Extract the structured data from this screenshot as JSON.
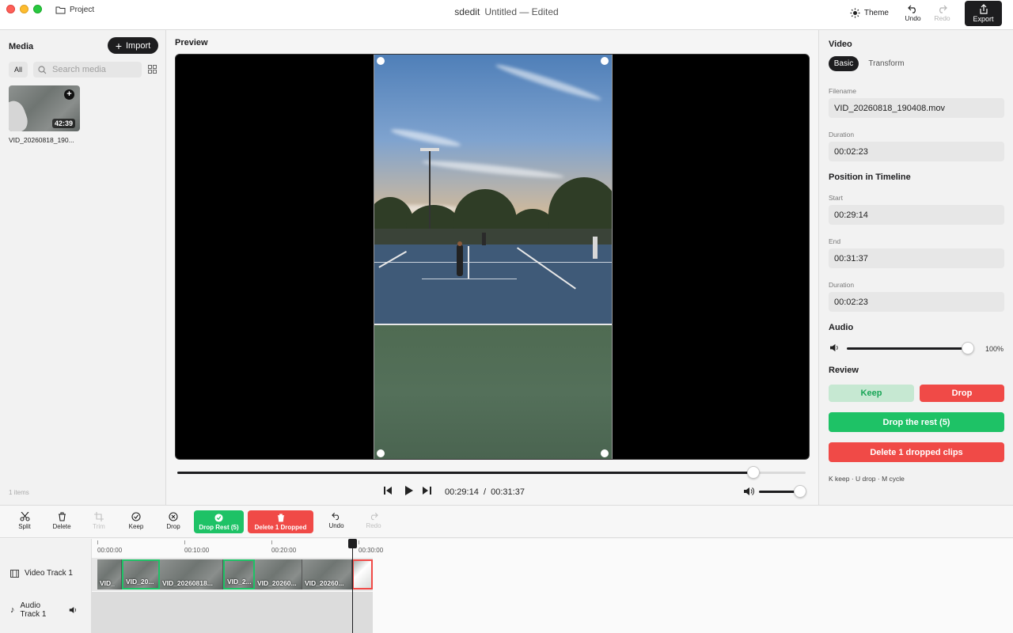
{
  "window": {
    "project_label": "Project",
    "app_name": "sdedit",
    "document_title": "Untitled — Edited",
    "theme_label": "Theme",
    "undo_label": "Undo",
    "redo_label": "Redo",
    "export_label": "Export"
  },
  "media": {
    "title": "Media",
    "import_label": "Import",
    "filter_all": "All",
    "search_placeholder": "Search media",
    "items": [
      {
        "name": "VID_20260818_190...",
        "duration": "42:39"
      }
    ],
    "count_label": "1 items"
  },
  "preview": {
    "title": "Preview",
    "current_time": "00:29:14",
    "separator": "/",
    "end_time": "00:31:37",
    "playback_position": 0.917,
    "volume_level": 0.83
  },
  "inspector": {
    "section_title": "Video",
    "tabs": [
      {
        "label": "Basic",
        "active": true
      },
      {
        "label": "Transform",
        "active": false
      }
    ],
    "filename_label": "Filename",
    "filename": "VID_20260818_190408.mov",
    "duration_label": "Duration",
    "duration": "00:02:23",
    "position_title": "Position in Timeline",
    "start_label": "Start",
    "start": "00:29:14",
    "end_label": "End",
    "end": "00:31:37",
    "timeline_duration_label": "Duration",
    "timeline_duration": "00:02:23",
    "audio_title": "Audio",
    "audio_percent": "100%",
    "review_title": "Review",
    "keep_label": "Keep",
    "drop_label": "Drop",
    "drop_rest_label": "Drop the rest (5)",
    "delete_dropped_label": "Delete 1 dropped clips",
    "shortcuts_hint": "K keep · U drop · M cycle"
  },
  "toolbar": {
    "split": "Split",
    "delete": "Delete",
    "trim": "Trim",
    "keep": "Keep",
    "drop": "Drop",
    "drop_rest": "Drop Rest (5)",
    "delete_dropped": "Delete 1 Dropped",
    "undo": "Undo",
    "redo": "Redo"
  },
  "timeline": {
    "ruler": [
      "00:00:00",
      "00:10:00",
      "00:20:00",
      "00:30:00"
    ],
    "video_track": "Video Track 1",
    "audio_track": "Audio Track 1",
    "clips": [
      {
        "label": "VID_",
        "state": "normal"
      },
      {
        "label": "VID_20...",
        "state": "kept"
      },
      {
        "label": "VID_20260818...",
        "state": "normal"
      },
      {
        "label": "VID_2...",
        "state": "kept"
      },
      {
        "label": "VID_20260...",
        "state": "normal"
      },
      {
        "label": "VID_20260...",
        "state": "normal"
      },
      {
        "label": "",
        "state": "dropped"
      }
    ]
  },
  "colors": {
    "accent_dark": "#1d1d1f",
    "keep_green": "#1ec266",
    "drop_red": "#f04a47"
  }
}
